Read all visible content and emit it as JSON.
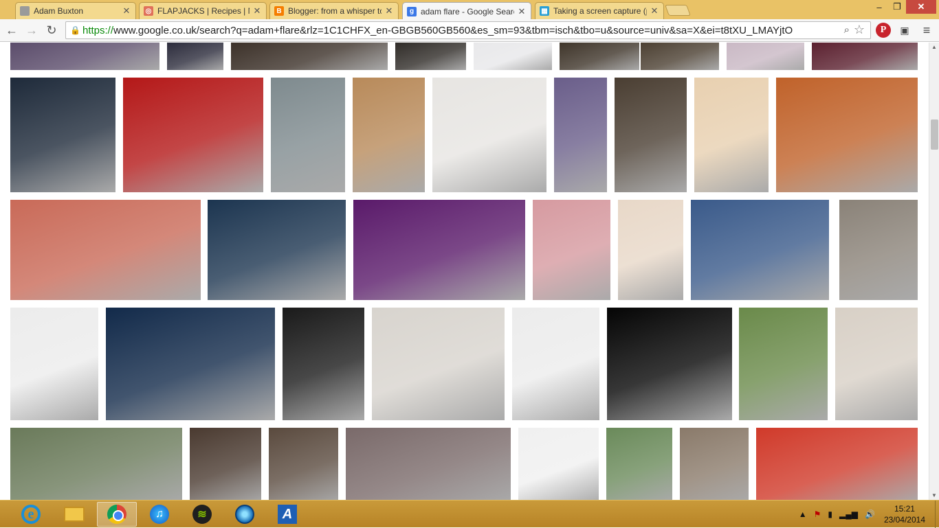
{
  "browser": {
    "tabs": [
      {
        "title": "Adam Buxton",
        "favicon_color": "#9a9a9a",
        "favicon_glyph": "",
        "active": false
      },
      {
        "title": "FLAPJACKS | Recipes | Nig",
        "favicon_color": "#e0705a",
        "favicon_glyph": "◎",
        "active": false
      },
      {
        "title": "Blogger: from a whisper to",
        "favicon_color": "#f57d00",
        "favicon_glyph": "B",
        "active": false
      },
      {
        "title": "adam flare - Google Searc",
        "favicon_color": "#3b78e7",
        "favicon_glyph": "g",
        "active": true
      },
      {
        "title": "Taking a screen capture (p",
        "favicon_color": "#2a9fd6",
        "favicon_glyph": "▦",
        "active": false
      }
    ],
    "window_controls": {
      "minimize": "–",
      "maximize": "❐",
      "close": "✕"
    },
    "address_bar": {
      "scheme": "https://",
      "rest": "www.google.co.uk/search?q=adam+flare&rlz=1C1CHFX_en-GBGB560GB560&es_sm=93&tbm=isch&tbo=u&source=univ&sa=X&ei=t8tXU_LMAYjtO"
    },
    "icons": {
      "back": "back-arrow-icon",
      "forward": "forward-arrow-icon",
      "reload": "reload-icon",
      "lock": "lock-icon",
      "search": "search-icon",
      "star": "star-icon",
      "pinterest": "pinterest-icon",
      "extension": "extension-icon",
      "menu": "menu-icon"
    }
  },
  "image_rows": [
    [
      {
        "label": "stage-legs",
        "color": "#5a4b6a"
      },
      {
        "label": "dark-small",
        "color": "#2a2a3a"
      },
      {
        "label": "leather-jacket",
        "color": "#3b3028"
      },
      {
        "label": "black-outfit",
        "color": "#2e2a26"
      },
      {
        "label": "product-sheet",
        "color": "#e8e8ea"
      },
      {
        "label": "runway-legs",
        "color": "#3d3328"
      },
      {
        "label": "runway-legs-2",
        "color": "#4a3e30"
      },
      {
        "label": "magazine-cover",
        "color": "#c9b8c4"
      },
      {
        "label": "pink-red-graphic",
        "color": "#5a1f2e"
      }
    ],
    [
      {
        "label": "bare-feet-jeans",
        "color": "#1e2a3a"
      },
      {
        "label": "concert-red-lights",
        "color": "#b41818"
      },
      {
        "label": "street-style-man",
        "color": "#7e8a8e"
      },
      {
        "label": "blonde-street-style",
        "color": "#b88a5a"
      },
      {
        "label": "pink-top-grey-skirt",
        "color": "#e7e5e2"
      },
      {
        "label": "red-carpet-suit",
        "color": "#6a5e8a"
      },
      {
        "label": "black-coat-woman",
        "color": "#4a3e32"
      },
      {
        "label": "runway-flares",
        "color": "#e8d0b0"
      },
      {
        "label": "crowd-hands-orange",
        "color": "#c0622a"
      }
    ],
    [
      {
        "label": "smoke-flare-football",
        "color": "#c96a58"
      },
      {
        "label": "software-screenshot-flare",
        "color": "#1c3550"
      },
      {
        "label": "live-music-venue",
        "color": "#5a1a6a"
      },
      {
        "label": "pink-dress-portrait",
        "color": "#d69aa0"
      },
      {
        "label": "illustrated-woman-flares",
        "color": "#e8d8c8"
      },
      {
        "label": "glowing-eyes-face",
        "color": "#3a5a8a"
      },
      {
        "label": "street-woman-flares",
        "color": "#8a8278"
      }
    ],
    [
      {
        "label": "layer-properties-panel",
        "color": "#ececec"
      },
      {
        "label": "adam-singing-stage",
        "color": "#122a4a"
      },
      {
        "label": "celestial-flare-card",
        "color": "#1a1a1a"
      },
      {
        "label": "baseball-cap-player",
        "color": "#d8d4ce"
      },
      {
        "label": "layer-properties-panel-2",
        "color": "#ececec"
      },
      {
        "label": "white-light-dark",
        "color": "#050505"
      },
      {
        "label": "man-with-dogs",
        "color": "#6a8a4a"
      },
      {
        "label": "comic-woman-drawing",
        "color": "#d8d0c6"
      }
    ],
    [
      {
        "label": "white-opel-car",
        "color": "#6a7a5a"
      },
      {
        "label": "blonde-leather-jacket",
        "color": "#4a3a30"
      },
      {
        "label": "woman-black-jacket",
        "color": "#5a4a3e"
      },
      {
        "label": "hockey-players-pepsi",
        "color": "#7a6a6a"
      },
      {
        "label": "perfume-bottle",
        "color": "#f0f0f0"
      },
      {
        "label": "yellow-skirt-woman",
        "color": "#6a8a5a"
      },
      {
        "label": "woman-graffiti-wall",
        "color": "#8a7a6a"
      },
      {
        "label": "red-flares-stadium",
        "color": "#d03a2a"
      }
    ]
  ],
  "taskbar": {
    "apps": [
      {
        "name": "internet-explorer",
        "glyph": "e",
        "active": false
      },
      {
        "name": "file-explorer",
        "glyph": "",
        "active": false
      },
      {
        "name": "chrome",
        "glyph": "",
        "active": true
      },
      {
        "name": "itunes",
        "glyph": "♫",
        "active": false
      },
      {
        "name": "spotify",
        "glyph": "≋",
        "active": false
      },
      {
        "name": "media-player",
        "glyph": "",
        "active": false
      },
      {
        "name": "aviary",
        "glyph": "A",
        "active": false
      }
    ],
    "tray": {
      "up_arrow": "▲",
      "flag": "⚑",
      "battery": "▮",
      "signal": "▂▄▆",
      "volume": "🔊"
    },
    "clock": {
      "time": "15:21",
      "date": "23/04/2014"
    }
  }
}
